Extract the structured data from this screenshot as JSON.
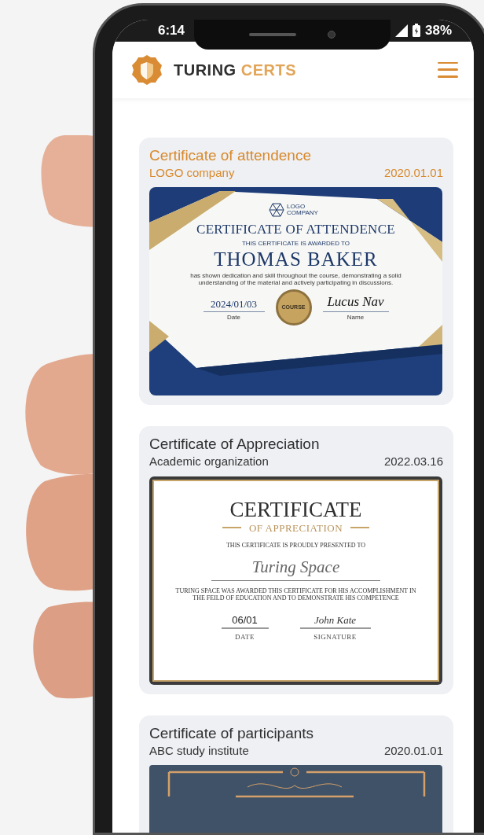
{
  "status_bar": {
    "time": "6:14",
    "battery": "38%"
  },
  "header": {
    "brand_primary": "TURING",
    "brand_accent": "CERTS"
  },
  "cards": [
    {
      "title": "Certificate of attendence",
      "issuer": "LOGO company",
      "date": "2020.01.01",
      "highlighted": true,
      "certificate": {
        "kind": "attendance",
        "logo": "LOGO COMPANY",
        "heading": "CERTIFICATE OF ATTENDENCE",
        "intro": "THIS CERTIFICATE IS AWARDED TO",
        "recipient": "THOMAS BAKER",
        "body": "has shown dedication and skill throughout the course, demonstrating a solid understanding of the material and actively participating in discussions.",
        "date_value": "2024/01/03",
        "date_label": "Date",
        "seal": "COURSE",
        "signature": "Lucus Nav",
        "signature_label": "Name"
      }
    },
    {
      "title": "Certificate of Appreciation",
      "issuer": "Academic organization",
      "date": "2022.03.16",
      "highlighted": false,
      "certificate": {
        "kind": "appreciation",
        "heading": "CERTIFICATE",
        "subheading": "OF APPRECIATION",
        "intro": "THIS CERTIFICATE IS PROUDLY PRESENTED TO",
        "recipient": "Turing Space",
        "body": "TURING SPACE WAS AWARDED THIS CERTIFICATE FOR HIS ACCOMPLISHMENT IN THE FEILD OF EDUCATION AND TO DEMONSTRATE HIS COMPETENCE",
        "date_value": "06/01",
        "date_label": "DATE",
        "signature": "John Kate",
        "signature_label": "SIGNATURE"
      }
    },
    {
      "title": "Certificate of participants",
      "issuer": "ABC study institute",
      "date": "2020.01.01",
      "highlighted": false,
      "certificate": {
        "kind": "ornate"
      }
    }
  ]
}
